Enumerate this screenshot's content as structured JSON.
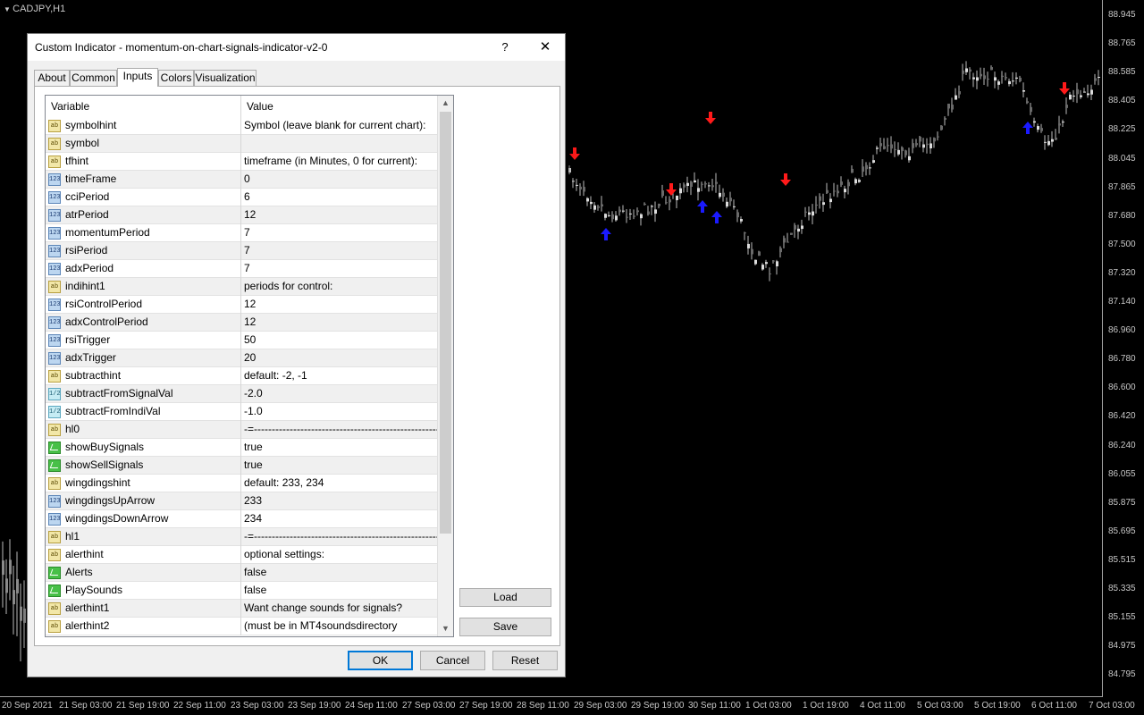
{
  "chart": {
    "symbol_label": "CADJPY,H1",
    "price_labels": [
      "88.945",
      "88.765",
      "88.585",
      "88.405",
      "88.225",
      "88.045",
      "87.865",
      "87.680",
      "87.500",
      "87.320",
      "87.140",
      "86.960",
      "86.780",
      "86.600",
      "86.420",
      "86.240",
      "86.055",
      "85.875",
      "85.695",
      "85.515",
      "85.335",
      "85.155",
      "84.975",
      "84.795"
    ],
    "time_labels": [
      "20 Sep 2021",
      "21 Sep 03:00",
      "21 Sep 19:00",
      "22 Sep 11:00",
      "23 Sep 03:00",
      "23 Sep 19:00",
      "24 Sep 11:00",
      "27 Sep 03:00",
      "27 Sep 19:00",
      "28 Sep 11:00",
      "29 Sep 03:00",
      "29 Sep 19:00",
      "30 Sep 11:00",
      "1 Oct 03:00",
      "1 Oct 19:00",
      "4 Oct 11:00",
      "5 Oct 03:00",
      "5 Oct 19:00",
      "6 Oct 11:00",
      "7 Oct 03:00"
    ],
    "buy_arrow_color": "#1a1aff",
    "sell_arrow_color": "#ff1a1a"
  },
  "dialog": {
    "title": "Custom Indicator - momentum-on-chart-signals-indicator-v2-0",
    "help_label": "?",
    "close_label": "✕",
    "tabs": [
      {
        "label": "About"
      },
      {
        "label": "Common"
      },
      {
        "label": "Inputs",
        "active": true
      },
      {
        "label": "Colors"
      },
      {
        "label": "Visualization"
      }
    ],
    "grid": {
      "header_variable": "Variable",
      "header_value": "Value",
      "rows": [
        {
          "type": "str",
          "name": "symbolhint",
          "value": "Symbol (leave blank for current chart):"
        },
        {
          "type": "str",
          "name": "symbol",
          "value": ""
        },
        {
          "type": "str",
          "name": "tfhint",
          "value": "timeframe (in Minutes, 0 for current):"
        },
        {
          "type": "int",
          "name": "timeFrame",
          "value": "0"
        },
        {
          "type": "int",
          "name": "cciPeriod",
          "value": "6"
        },
        {
          "type": "int",
          "name": "atrPeriod",
          "value": "12"
        },
        {
          "type": "int",
          "name": "momentumPeriod",
          "value": "7"
        },
        {
          "type": "int",
          "name": "rsiPeriod",
          "value": "7"
        },
        {
          "type": "int",
          "name": "adxPeriod",
          "value": "7"
        },
        {
          "type": "str",
          "name": "indihint1",
          "value": "periods for control:"
        },
        {
          "type": "int",
          "name": "rsiControlPeriod",
          "value": "12"
        },
        {
          "type": "int",
          "name": "adxControlPeriod",
          "value": "12"
        },
        {
          "type": "int",
          "name": "rsiTrigger",
          "value": "50"
        },
        {
          "type": "int",
          "name": "adxTrigger",
          "value": "20"
        },
        {
          "type": "str",
          "name": "subtracthint",
          "value": "default: -2, -1"
        },
        {
          "type": "dbl",
          "name": "subtractFromSignalVal",
          "value": "-2.0"
        },
        {
          "type": "dbl",
          "name": "subtractFromIndiVal",
          "value": "-1.0"
        },
        {
          "type": "str",
          "name": "hl0",
          "value": "-=-------------------------------------------------------=-"
        },
        {
          "type": "bool",
          "name": "showBuySignals",
          "value": "true"
        },
        {
          "type": "bool",
          "name": "showSellSignals",
          "value": "true"
        },
        {
          "type": "str",
          "name": "wingdingshint",
          "value": "default: 233, 234"
        },
        {
          "type": "int",
          "name": "wingdingsUpArrow",
          "value": "233"
        },
        {
          "type": "int",
          "name": "wingdingsDownArrow",
          "value": "234"
        },
        {
          "type": "str",
          "name": "hl1",
          "value": "-=-------------------------------------------------------=-"
        },
        {
          "type": "str",
          "name": "alerthint",
          "value": "optional settings:"
        },
        {
          "type": "bool",
          "name": "Alerts",
          "value": "false"
        },
        {
          "type": "bool",
          "name": "PlaySounds",
          "value": "false"
        },
        {
          "type": "str",
          "name": "alerthint1",
          "value": "Want change sounds for signals?"
        },
        {
          "type": "str",
          "name": "alerthint2",
          "value": "(must be in MT4soundsdirectory"
        }
      ]
    },
    "icon_text": {
      "str": "ab",
      "int": "123",
      "dbl": "1/2",
      "bool": ""
    },
    "buttons": {
      "load": "Load",
      "save": "Save",
      "ok": "OK",
      "cancel": "Cancel",
      "reset": "Reset"
    }
  }
}
